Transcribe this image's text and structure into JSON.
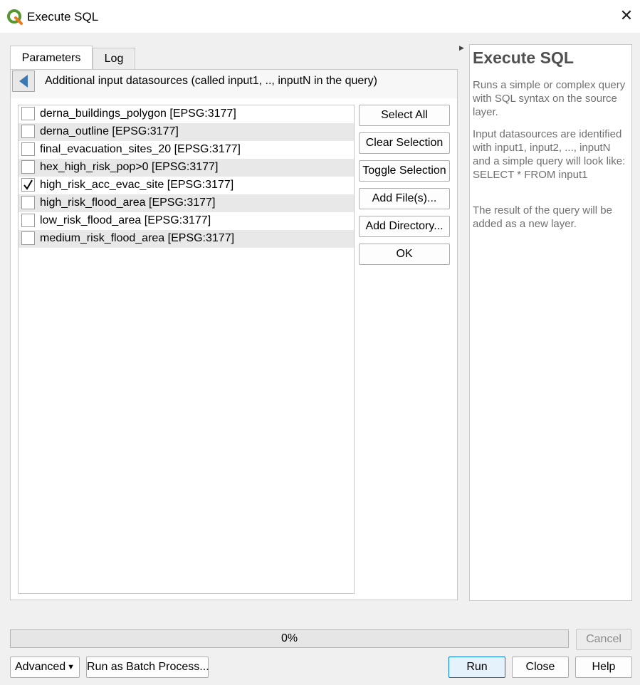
{
  "window": {
    "title": "Execute SQL",
    "close_symbol": "✕"
  },
  "tabs": [
    {
      "label": "Parameters",
      "active": true
    },
    {
      "label": "Log",
      "active": false
    }
  ],
  "panel": {
    "title": "Additional input datasources (called input1, .., inputN in the query)"
  },
  "layers": [
    {
      "label": "derna_buildings_polygon [EPSG:3177]",
      "checked": false
    },
    {
      "label": "derna_outline [EPSG:3177]",
      "checked": false
    },
    {
      "label": "final_evacuation_sites_20 [EPSG:3177]",
      "checked": false
    },
    {
      "label": "hex_high_risk_pop>0 [EPSG:3177]",
      "checked": false
    },
    {
      "label": "high_risk_acc_evac_site [EPSG:3177]",
      "checked": true
    },
    {
      "label": "high_risk_flood_area [EPSG:3177]",
      "checked": false
    },
    {
      "label": "low_risk_flood_area [EPSG:3177]",
      "checked": false
    },
    {
      "label": "medium_risk_flood_area [EPSG:3177]",
      "checked": false
    }
  ],
  "side_buttons": {
    "select_all": "Select All",
    "clear_selection": "Clear Selection",
    "toggle_selection": "Toggle Selection",
    "add_files": "Add File(s)...",
    "add_directory": "Add Directory...",
    "ok": "OK"
  },
  "help": {
    "title": "Execute SQL",
    "p1": "Runs a simple or complex query with SQL syntax on the source layer.",
    "p2": "Input datasources are identified with input1, input2, ..., inputN and a simple query will look like: SELECT * FROM input1",
    "p3": "The result of the query will be added as a new layer."
  },
  "progress": {
    "value": 0,
    "text": "0%"
  },
  "bottom": {
    "cancel": "Cancel",
    "advanced": "Advanced",
    "batch": "Run as Batch Process...",
    "run": "Run",
    "close": "Close",
    "help": "Help"
  },
  "colors": {
    "accent": "#0078d7",
    "qgis_green": "#589632",
    "progress_fill": "#06b025"
  },
  "icons": {
    "app": "qgis-logo-icon",
    "back": "arrow-left-icon",
    "check": "checkmark-icon"
  }
}
